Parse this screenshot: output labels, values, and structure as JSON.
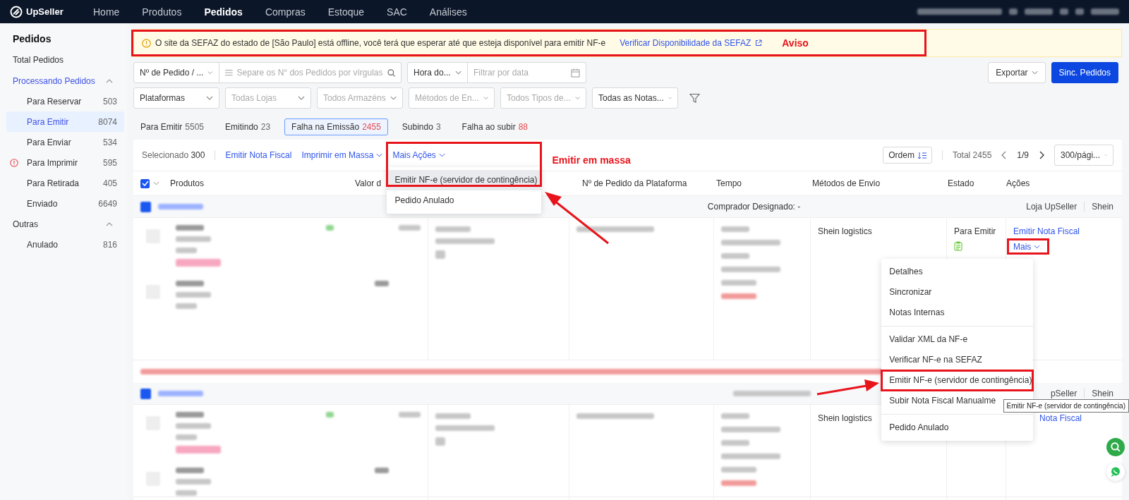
{
  "top_nav": {
    "logo": "UpSeller",
    "items": [
      {
        "label": "Home",
        "selected": false
      },
      {
        "label": "Produtos",
        "selected": false
      },
      {
        "label": "Pedidos",
        "selected": true
      },
      {
        "label": "Compras",
        "selected": false
      },
      {
        "label": "Estoque",
        "selected": false
      },
      {
        "label": "SAC",
        "selected": false
      },
      {
        "label": "Análises",
        "selected": false
      }
    ]
  },
  "sidebar": {
    "title": "Pedidos",
    "items": [
      {
        "kind": "link",
        "label": "Total Pedidos"
      },
      {
        "kind": "group",
        "label": "Processando Pedidos",
        "selected": true,
        "expanded": true,
        "children": [
          {
            "label": "Para Reservar",
            "count": "503",
            "selected": false,
            "alert": false
          },
          {
            "label": "Para Emitir",
            "count": "8074",
            "selected": true,
            "alert": false
          },
          {
            "label": "Para Enviar",
            "count": "534",
            "selected": false,
            "alert": false
          },
          {
            "label": "Para Imprimir",
            "count": "595",
            "selected": false,
            "alert": true
          },
          {
            "label": "Para Retirada",
            "count": "405",
            "selected": false,
            "alert": false
          },
          {
            "label": "Enviado",
            "count": "6649",
            "selected": false,
            "alert": false
          }
        ]
      },
      {
        "kind": "group",
        "label": "Outras",
        "selected": false,
        "expanded": true,
        "children": [
          {
            "label": "Anulado",
            "count": "816",
            "selected": false,
            "alert": false
          }
        ]
      }
    ]
  },
  "banner": {
    "message": "O site da SEFAZ do estado de [São Paulo] está offline, você terá que esperar até que esteja disponível para emitir NF-e",
    "link": "Verificar Disponibilidade da SEFAZ",
    "annotation": "Aviso"
  },
  "filters": {
    "row_1": [
      {
        "kind": "select",
        "value": "Nº de Pedido / ..."
      },
      {
        "kind": "search",
        "placeholder": "Separe os N° dos Pedidos por vírgulas"
      },
      {
        "kind": "select",
        "value": "Hora do..."
      },
      {
        "kind": "date",
        "placeholder": "Filtrar por data"
      }
    ],
    "row_2": [
      {
        "kind": "select",
        "value": "Plataformas"
      },
      {
        "kind": "select",
        "placeholder": "Todas Lojas"
      },
      {
        "kind": "select",
        "placeholder": "Todos Armazéns"
      },
      {
        "kind": "select",
        "placeholder": "Métodos de En..."
      },
      {
        "kind": "select",
        "placeholder": "Todos Tipos de..."
      },
      {
        "kind": "select",
        "value": "Todas as Notas..."
      }
    ],
    "export": "Exportar",
    "sync": "Sinc. Pedidos"
  },
  "status_tabs": [
    {
      "label": "Para Emitir",
      "count": "5505",
      "selected": false,
      "alert": false
    },
    {
      "label": "Emitindo",
      "count": "23",
      "selected": false,
      "alert": false
    },
    {
      "label": "Falha na Emissão",
      "count": "2455",
      "selected": true,
      "alert": true
    },
    {
      "label": "Subindo",
      "count": "3",
      "selected": false,
      "alert": false
    },
    {
      "label": "Falha ao subir",
      "count": "88",
      "selected": false,
      "alert": true
    }
  ],
  "toolbar": {
    "selected_label": "Selecionado",
    "selected_count": "300",
    "actions": [
      {
        "kind": "link",
        "label": "Emitir Nota Fiscal"
      },
      {
        "kind": "dropdown",
        "label": "Imprimir em Massa"
      },
      {
        "kind": "dropdown",
        "label": "Mais Ações",
        "menu": {
          "annotation": "Emitir em massa",
          "items": [
            {
              "label": "Emitir NF-e (servidor de contingência)",
              "selected": true
            },
            {
              "label": "Pedido Anulado",
              "selected": false
            }
          ]
        }
      }
    ],
    "order_button": "Ordem",
    "total": "Total 2455",
    "page": "1/9",
    "page_size": "300/pági..."
  },
  "table": {
    "header_checkbox": {
      "checked": true
    },
    "columns": [
      "Produtos",
      "Valor d",
      "Nº de Pedido da Plataforma",
      "Tempo",
      "Métodos de Envio",
      "Estado",
      "Ações"
    ],
    "orders": [
      {
        "checked": true,
        "buyer": "Comprador Designado: -",
        "store": "Loja UpSeller",
        "platform": "Shein",
        "shipping": "Shein logistics",
        "status": "Para Emitir",
        "action": "Emitir Nota Fiscal",
        "more": "Mais",
        "error": true,
        "menu": {
          "tooltip": "Emitir NF-e (servidor de contingência)",
          "groups": [
            [
              {
                "label": "Detalhes",
                "annotated": false
              },
              {
                "label": "Sincronizar",
                "annotated": false
              },
              {
                "label": "Notas Internas",
                "annotated": false
              }
            ],
            [
              {
                "label": "Validar XML da NF-e",
                "annotated": false
              },
              {
                "label": "Verificar NF-e na SEFAZ",
                "annotated": false
              },
              {
                "label": "Emitir NF-e (servidor de contingência)",
                "annotated": true
              },
              {
                "label": "Subir Nota Fiscal Manualme",
                "annotated": false
              }
            ],
            [
              {
                "label": "Pedido Anulado",
                "annotated": false
              }
            ]
          ]
        }
      },
      {
        "checked": true,
        "store": "pSeller",
        "platform": "Shein",
        "shipping": "Shein logistics",
        "action": "Nota Fiscal",
        "error": false
      }
    ]
  }
}
